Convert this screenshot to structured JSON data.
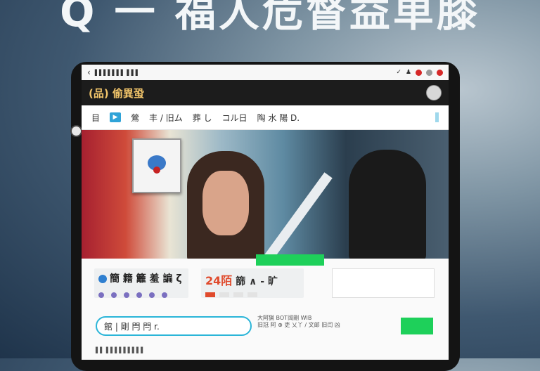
{
  "headline": "Q 一 福人危督益单膝",
  "statusbar": {
    "back_glyph": "‹",
    "left_text": "▌▌▌▌▌▌▌ ▌▌▌",
    "colors": {
      "red": "#d62828",
      "gray": "#9a9a9a"
    }
  },
  "app": {
    "title": "(品) 偷異蛩"
  },
  "nav": {
    "items": [
      "目",
      "鶯",
      "丰 / 旧ム",
      "葬 し",
      "コル日",
      "陶 水 陽 D."
    ]
  },
  "hero": {},
  "panel_left": {
    "text": "簡 籍 籬 羞 諞 ζ"
  },
  "panel_mid": {
    "number": "24陌",
    "text": "篩 ∧ - 旷"
  },
  "search": {
    "value": "館 | 剛 閂 閂 r."
  },
  "info": {
    "line1": "大阿猟 BOT阔剛 WIB",
    "line2": "旧冠 阿 ⊕ 吏 乂丫 / 文邮 旧闫 凶"
  },
  "bottom": {
    "text": "▌▌ ▌▌▌▌▌▌▌▌▌"
  },
  "colors": {
    "accent_green": "#1ed05a",
    "accent_cyan": "#2bb5d8",
    "title_gold": "#f1c46a",
    "highlight_red": "#e04a2c"
  }
}
